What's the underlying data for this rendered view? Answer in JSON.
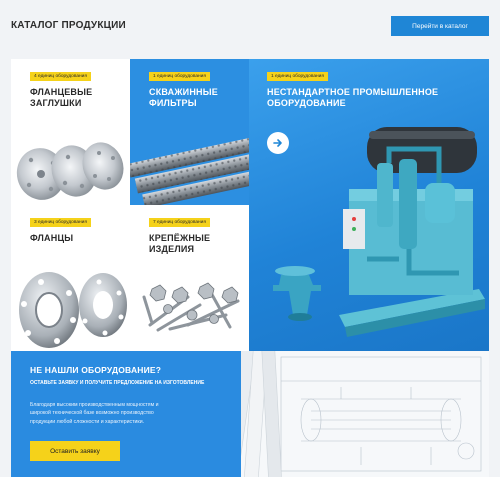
{
  "header": {
    "title": "КАТАЛОГ ПРОДУКЦИИ",
    "catalog_button": "Перейти в каталог"
  },
  "cards": [
    {
      "badge": "4 единиц оборудования",
      "title_line1": "ФЛАНЦЕВЫЕ",
      "title_line2": "ЗАГЛУШКИ"
    },
    {
      "badge": "1 единиц оборудования",
      "title_line1": "СКВАЖИННЫЕ",
      "title_line2": "ФИЛЬТРЫ"
    },
    {
      "badge": "3 единиц оборудования",
      "title_line1": "ФЛАНЦЫ",
      "title_line2": ""
    },
    {
      "badge": "7 единиц оборудования",
      "title_line1": "КРЕПЁЖНЫЕ",
      "title_line2": "ИЗДЕЛИЯ"
    },
    {
      "badge": "1 единиц оборудования",
      "title_line1": "НЕСТАНДАРТНОЕ ПРОМЫШЛЕННОЕ",
      "title_line2": "ОБОРУДОВАНИЕ"
    }
  ],
  "banner": {
    "title": "НЕ НАШЛИ ОБОРУДОВАНИЕ?",
    "subtitle": "ОСТАВЬТЕ ЗАЯВКУ И ПОЛУЧИТЕ ПРЕДЛОЖЕНИЕ НА ИЗГОТОВЛЕНИЕ",
    "text_line1": "Благодаря высоким производственным мощностям и",
    "text_line2": "широкой технической базе возможно производство",
    "text_line3": "продукции любой сложности и характеристики.",
    "button": "Оставить заявку"
  },
  "icons": {
    "next": "arrow-right-icon",
    "request": "arrow-right-icon"
  },
  "colors": {
    "accent_blue": "#1f86d6",
    "badge_yellow": "#f5d21a",
    "card_blue": "#2c8fe1"
  }
}
